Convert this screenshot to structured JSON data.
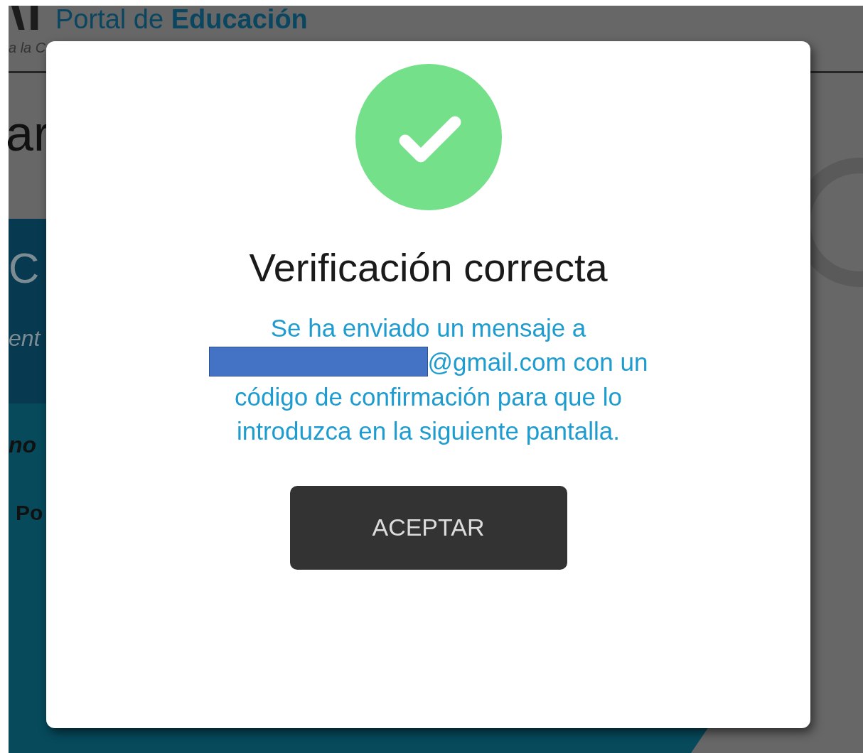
{
  "background_page": {
    "header_title": "Portal de **Educación**",
    "header_subtitle": "a la C",
    "heading": "ar",
    "band_title": "C",
    "band_subtitle": "ent",
    "section_label": "no",
    "field_label": "Po"
  },
  "dialog": {
    "title": "Verificación correcta",
    "message_before": "Se ha enviado un mensaje a",
    "email_redacted": true,
    "message_after": "@gmail.com con un código de confirmación para que lo introduzca en la siguiente pantalla.",
    "button": "ACEPTAR"
  }
}
